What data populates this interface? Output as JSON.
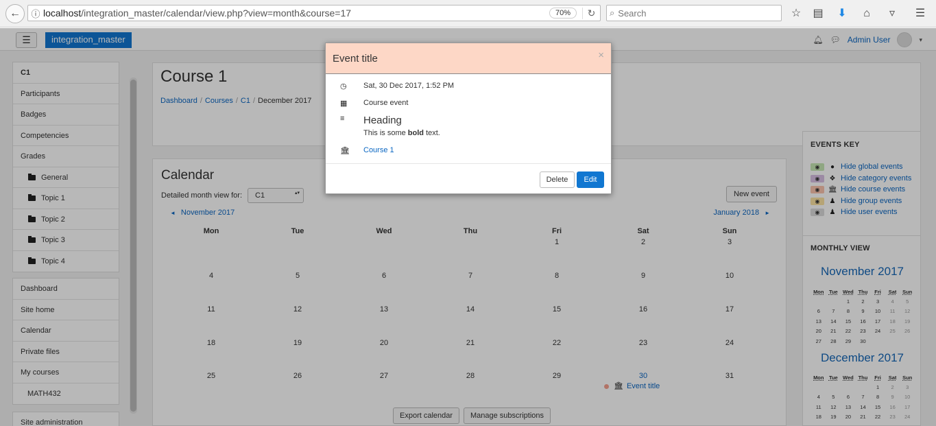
{
  "browser": {
    "url_host": "localhost",
    "url_path": "/integration_master/calendar/view.php?view=month&course=17",
    "zoom": "70%",
    "search_placeholder": "Search"
  },
  "navbar": {
    "brand": "integration_master",
    "user_name": "Admin User"
  },
  "drawer": {
    "course_items": [
      {
        "label": "C1"
      },
      {
        "label": "Participants"
      },
      {
        "label": "Badges"
      },
      {
        "label": "Competencies"
      },
      {
        "label": "Grades"
      },
      {
        "label": "General"
      },
      {
        "label": "Topic 1"
      },
      {
        "label": "Topic 2"
      },
      {
        "label": "Topic 3"
      },
      {
        "label": "Topic 4"
      }
    ],
    "site_items": [
      {
        "label": "Dashboard"
      },
      {
        "label": "Site home"
      },
      {
        "label": "Calendar"
      },
      {
        "label": "Private files"
      },
      {
        "label": "My courses"
      },
      {
        "label": "MATH432"
      }
    ],
    "admin_label": "Site administration"
  },
  "header": {
    "title": "Course 1",
    "breadcrumb": [
      "Dashboard",
      "Courses",
      "C1",
      "December 2017"
    ]
  },
  "calendar": {
    "title": "Calendar",
    "filter_label": "Detailed month view for:",
    "filter_value": "C1",
    "new_event": "New event",
    "prev_month": "November 2017",
    "next_month": "January 2018",
    "prev_arrow": "◄",
    "next_arrow": "►",
    "days": [
      "Mon",
      "Tue",
      "Wed",
      "Thu",
      "Fri",
      "Sat",
      "Sun"
    ],
    "weeks": [
      [
        "",
        "",
        "",
        "",
        "1",
        "2",
        "3"
      ],
      [
        "4",
        "5",
        "6",
        "7",
        "8",
        "9",
        "10"
      ],
      [
        "11",
        "12",
        "13",
        "14",
        "15",
        "16",
        "17"
      ],
      [
        "18",
        "19",
        "20",
        "21",
        "22",
        "23",
        "24"
      ],
      [
        "25",
        "26",
        "27",
        "28",
        "29",
        "30",
        "31"
      ]
    ],
    "event_label": "Event title",
    "export": "Export calendar",
    "manage": "Manage subscriptions"
  },
  "events_key": {
    "title": "EVENTS KEY",
    "items": [
      {
        "label": "Hide global events",
        "color": "#c7e8b4"
      },
      {
        "label": "Hide category events",
        "color": "#d8bfe4"
      },
      {
        "label": "Hide course events",
        "color": "#fbc4ae"
      },
      {
        "label": "Hide group events",
        "color": "#fde3a3"
      },
      {
        "label": "Hide user events",
        "color": "#dcdcdc"
      }
    ]
  },
  "monthly_view": {
    "title": "MONTHLY VIEW",
    "months": [
      {
        "name": "November 2017",
        "rows": [
          [
            "",
            "",
            "1",
            "2",
            "3",
            "4",
            "5"
          ],
          [
            "6",
            "7",
            "8",
            "9",
            "10",
            "11",
            "12"
          ],
          [
            "13",
            "14",
            "15",
            "16",
            "17",
            "18",
            "19"
          ],
          [
            "20",
            "21",
            "22",
            "23",
            "24",
            "25",
            "26"
          ],
          [
            "27",
            "28",
            "29",
            "30",
            "",
            "",
            ""
          ]
        ]
      },
      {
        "name": "December 2017",
        "rows": [
          [
            "",
            "",
            "",
            "",
            "1",
            "2",
            "3"
          ],
          [
            "4",
            "5",
            "6",
            "7",
            "8",
            "9",
            "10"
          ],
          [
            "11",
            "12",
            "13",
            "14",
            "15",
            "16",
            "17"
          ],
          [
            "18",
            "19",
            "20",
            "21",
            "22",
            "23",
            "24"
          ]
        ]
      }
    ]
  },
  "modal": {
    "title": "Event title",
    "close": "×",
    "date": "Sat, 30 Dec 2017, 1:52 PM",
    "type": "Course event",
    "heading": "Heading",
    "desc_before": "This is some ",
    "desc_bold": "bold",
    "desc_after": " text.",
    "course": "Course 1",
    "delete": "Delete",
    "edit": "Edit"
  }
}
